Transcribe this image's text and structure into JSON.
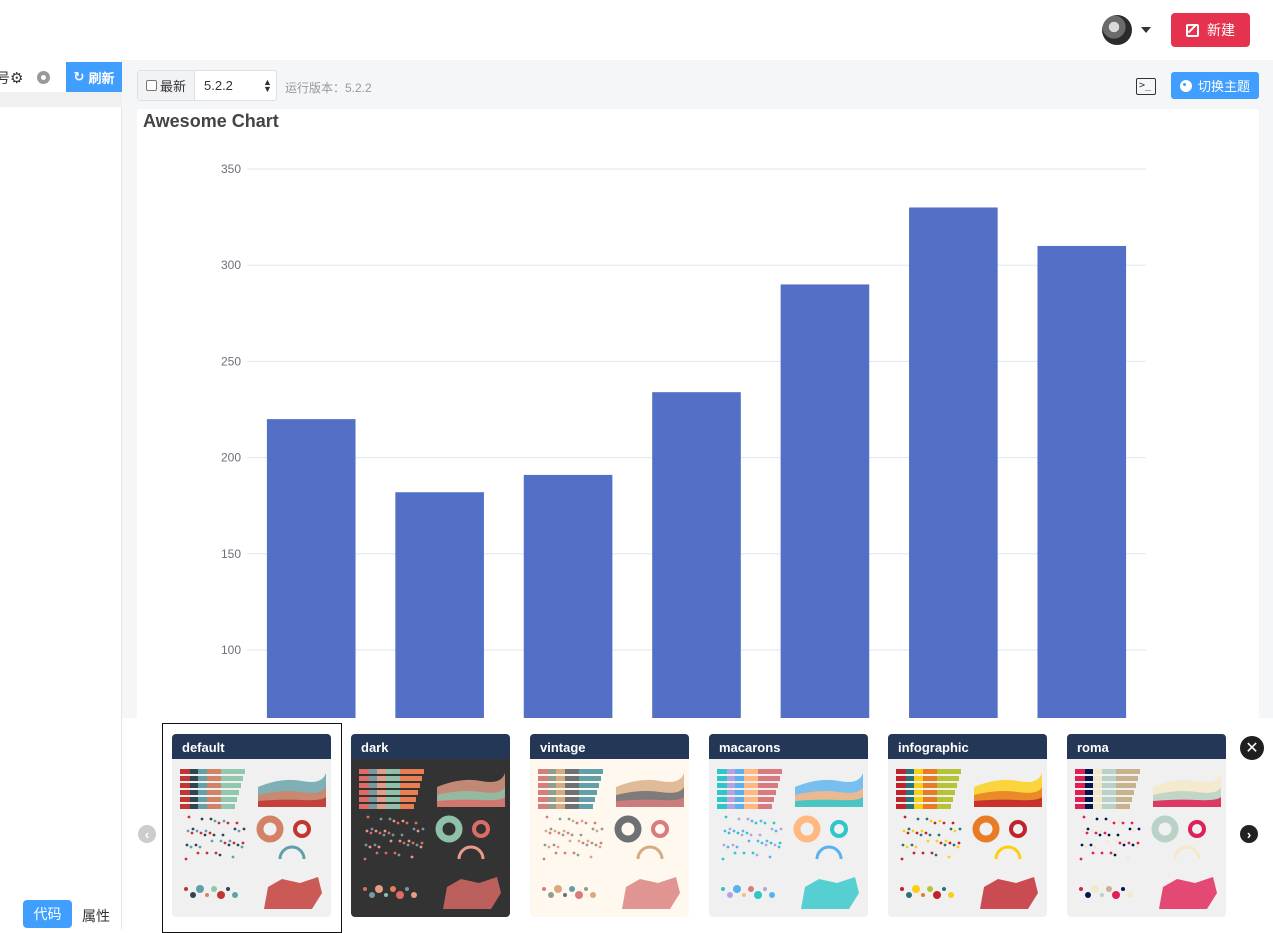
{
  "header": {
    "new_label": "新建"
  },
  "left_panel": {
    "partial_text": "号",
    "refresh_label": "刷新",
    "tabs": [
      {
        "label": "代码"
      },
      {
        "label": "属性"
      }
    ]
  },
  "toolbar": {
    "latest_label": "最新",
    "version_value": "5.2.2",
    "running_version": "运行版本：5.2.2",
    "theme_button_label": "切换主题",
    "terminal_icon_text": ">_"
  },
  "chart_data": {
    "type": "bar",
    "title": "Awesome Chart",
    "categories": [
      "",
      "",
      "",
      "",
      "",
      "",
      ""
    ],
    "values": [
      220,
      182,
      191,
      234,
      290,
      330,
      310
    ],
    "ylim": [
      0,
      350
    ],
    "yticks": [
      100,
      150,
      200,
      250,
      300,
      350
    ],
    "xlabel": "",
    "ylabel": "",
    "grid": true,
    "colors": {
      "bar": "#5470c6",
      "grid": "#e0e6f1",
      "axis_label": "#6e7079"
    }
  },
  "themes": [
    {
      "name": "default",
      "selected": true,
      "header": "#243756",
      "bg": "#f0f0f0",
      "palette": [
        "#c23531",
        "#2f4554",
        "#61a0a8",
        "#d48265",
        "#91c7ae"
      ]
    },
    {
      "name": "dark",
      "selected": false,
      "header": "#243756",
      "bg": "#333333",
      "palette": [
        "#dd6b66",
        "#759aa0",
        "#e69d87",
        "#8dc1a9",
        "#ea7e53"
      ]
    },
    {
      "name": "vintage",
      "selected": false,
      "header": "#243756",
      "bg": "#fef8ef",
      "palette": [
        "#d87c7c",
        "#919e8b",
        "#d7ab82",
        "#6e7074",
        "#61a0a8"
      ]
    },
    {
      "name": "macarons",
      "selected": false,
      "header": "#243756",
      "bg": "#f0f0f0",
      "palette": [
        "#2ec7c9",
        "#b6a2de",
        "#5ab1ef",
        "#ffb980",
        "#d87a80"
      ]
    },
    {
      "name": "infographic",
      "selected": false,
      "header": "#243756",
      "bg": "#f0f0f0",
      "palette": [
        "#c1232b",
        "#27727b",
        "#fcce10",
        "#e87c25",
        "#b5c334"
      ]
    },
    {
      "name": "roma",
      "selected": false,
      "header": "#243756",
      "bg": "#f0f0f0",
      "palette": [
        "#e01f54",
        "#001852",
        "#f5e8c8",
        "#b8d2c7",
        "#c6b38e"
      ]
    }
  ],
  "icons": {
    "prev": "‹",
    "next": "›",
    "close": "✕",
    "gear": "⚙",
    "refresh": "↻"
  }
}
